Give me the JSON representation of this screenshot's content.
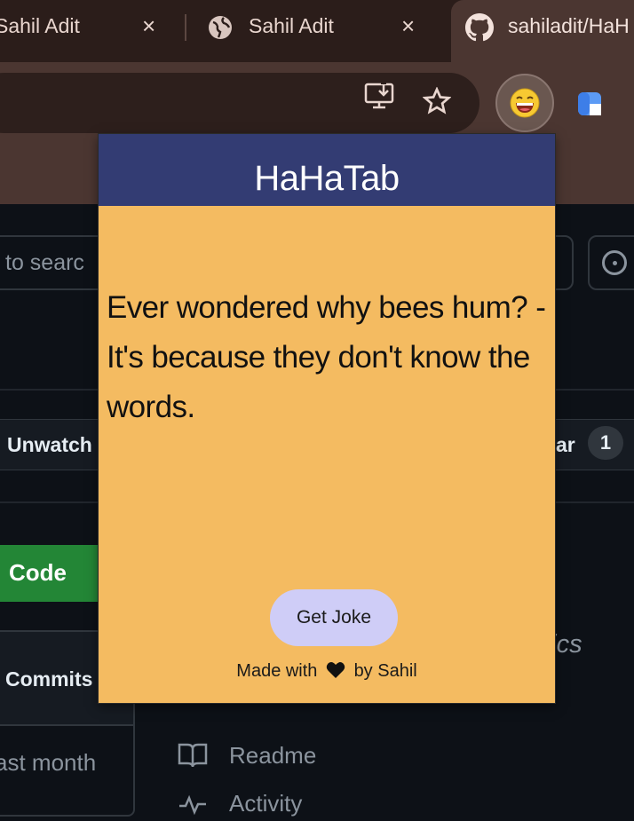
{
  "browser": {
    "tabs": [
      {
        "title": "Sahil Adit",
        "close": "×"
      },
      {
        "title": "Sahil Adit",
        "close": "×",
        "icon": "globe-icon"
      },
      {
        "title": "sahiladit/HaH",
        "icon": "github-icon",
        "active": true
      }
    ],
    "toolbar_icons": [
      "install-app-icon",
      "bookmark-star-icon",
      "hahatab-extension-icon",
      "blue-extension-icon"
    ]
  },
  "github_bg": {
    "search_text": "to searc",
    "unwatch_label": "Unwatch",
    "star_label": "ar",
    "star_count": "1",
    "code_button": "Code",
    "commits_label": "Commits",
    "last_commit": "ast month",
    "topics_text": "pics",
    "readme_label": "Readme",
    "activity_label": "Activity"
  },
  "popup": {
    "title": "HaHaTab",
    "joke": "Ever wondered why bees hum? - It's because they don't know the words.",
    "button_label": "Get Joke",
    "footer_prefix": "Made with",
    "footer_suffix": "by Sahil",
    "colors": {
      "header": "#333c73",
      "body": "#f4bb61",
      "button": "#cfcdf7"
    }
  }
}
